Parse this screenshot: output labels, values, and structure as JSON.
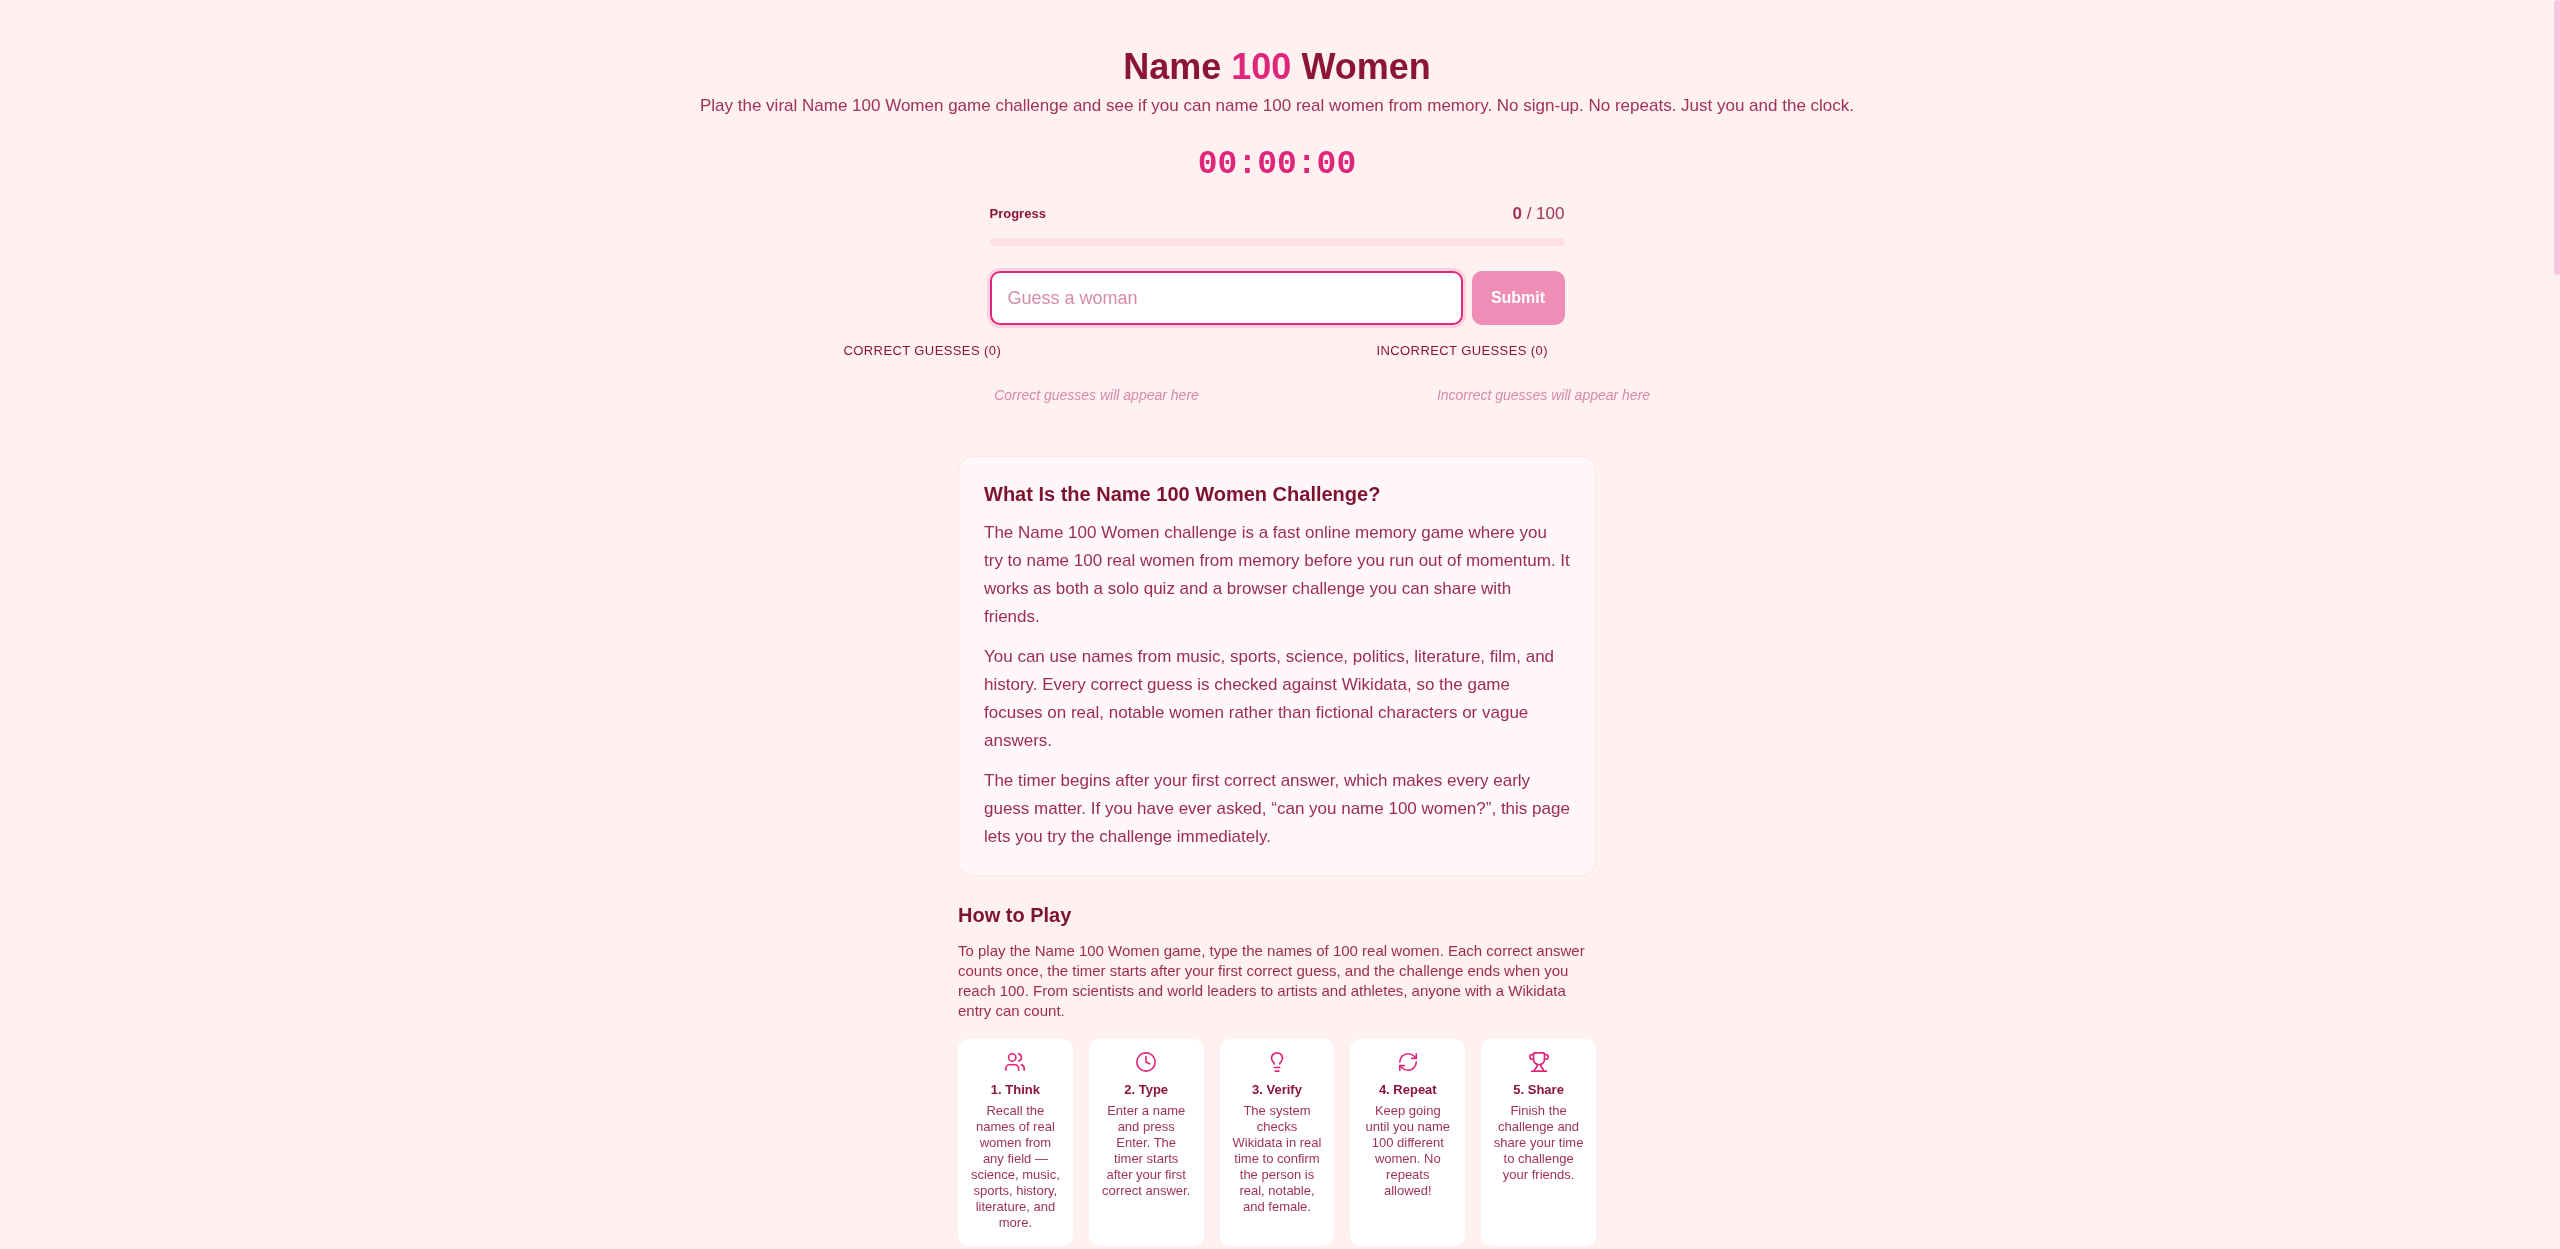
{
  "header": {
    "title": [
      {
        "text": "Name",
        "highlighted": false
      },
      {
        "text": "100",
        "highlighted": true
      },
      {
        "text": "Women",
        "highlighted": false
      }
    ],
    "subtitle": "Play the viral Name 100 Women game challenge and see if you can name 100 real women from memory. No sign-up. No repeats. Just you and the clock."
  },
  "game": {
    "timer": "00:00:00",
    "progress": {
      "label": "Progress",
      "reading": "**0** / 100",
      "level": 0
    },
    "guess_field": {
      "placeholder": "Guess a woman",
      "focused": true
    },
    "submit_button": {
      "label": "Submit",
      "disabled": true
    },
    "guess_lists": [
      {
        "heading": "CORRECT GUESSES (0)",
        "placeholder": "Correct guesses will appear here"
      },
      {
        "heading": "INCORRECT GUESSES (0)",
        "placeholder": "Incorrect guesses will appear here"
      }
    ]
  },
  "about": {
    "title": "What Is the Name 100 Women Challenge?",
    "paragraphs": [
      "The Name 100 Women challenge is a fast online memory game where you try to name 100 real women from memory before you run out of momentum. It works as both a solo quiz and a browser challenge you can share with friends.",
      "You can use names from music, sports, science, politics, literature, film, and history. Every correct guess is checked against Wikidata, so the game focuses on real, notable women rather than fictional characters or vague answers.",
      "The timer begins after your first correct answer, which makes every early guess matter. If you have ever asked, “can you name 100 women?”, this page lets you try the challenge immediately."
    ]
  },
  "how_to_play": {
    "title": "How to Play",
    "intro": "To play the Name 100 Women game, type the names of 100 real women. Each correct answer counts once, the timer starts after your first correct guess, and the challenge ends when you reach 100. From scientists and world leaders to artists and athletes, anyone with a Wikidata entry can count.",
    "steps": [
      {
        "title": "1. Think",
        "text": "Recall the names of real women from any field — science, music, sports, history, literature, and more."
      },
      {
        "title": "2. Type",
        "text": "Enter a name and press Enter. The timer starts after your first correct answer."
      },
      {
        "title": "3. Verify",
        "text": "The system checks Wikidata in real time to confirm the person is real, notable, and female."
      },
      {
        "title": "4. Repeat",
        "text": "Keep going until you name 100 different women. No repeats allowed!"
      },
      {
        "title": "5. Share",
        "text": "Finish the challenge and share your time to challenge your friends."
      }
    ]
  }
}
